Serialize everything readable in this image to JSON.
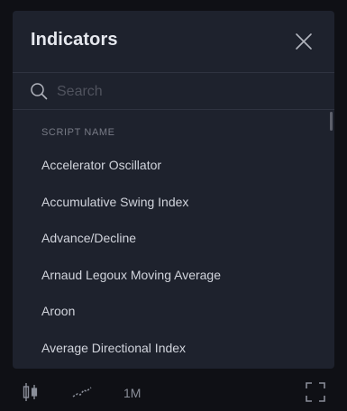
{
  "dialog": {
    "title": "Indicators",
    "close_icon": "close-icon",
    "search": {
      "placeholder": "Search",
      "value": "",
      "icon": "search-icon"
    },
    "section_header": "SCRIPT NAME",
    "items": [
      {
        "label": "Accelerator Oscillator"
      },
      {
        "label": "Accumulative Swing Index"
      },
      {
        "label": "Advance/Decline"
      },
      {
        "label": "Arnaud Legoux Moving Average"
      },
      {
        "label": "Aroon"
      },
      {
        "label": "Average Directional Index"
      }
    ]
  },
  "toolbar": {
    "chart_type_icon": "candlestick-icon",
    "indicator_icon": "trend-line-icon",
    "interval_label": "1M",
    "fullscreen_icon": "fullscreen-icon"
  },
  "colors": {
    "background": "#0f1015",
    "dialog_background": "#1e222d",
    "text": "#d1d4dc",
    "muted": "#787b86",
    "divider": "#2f3340"
  }
}
